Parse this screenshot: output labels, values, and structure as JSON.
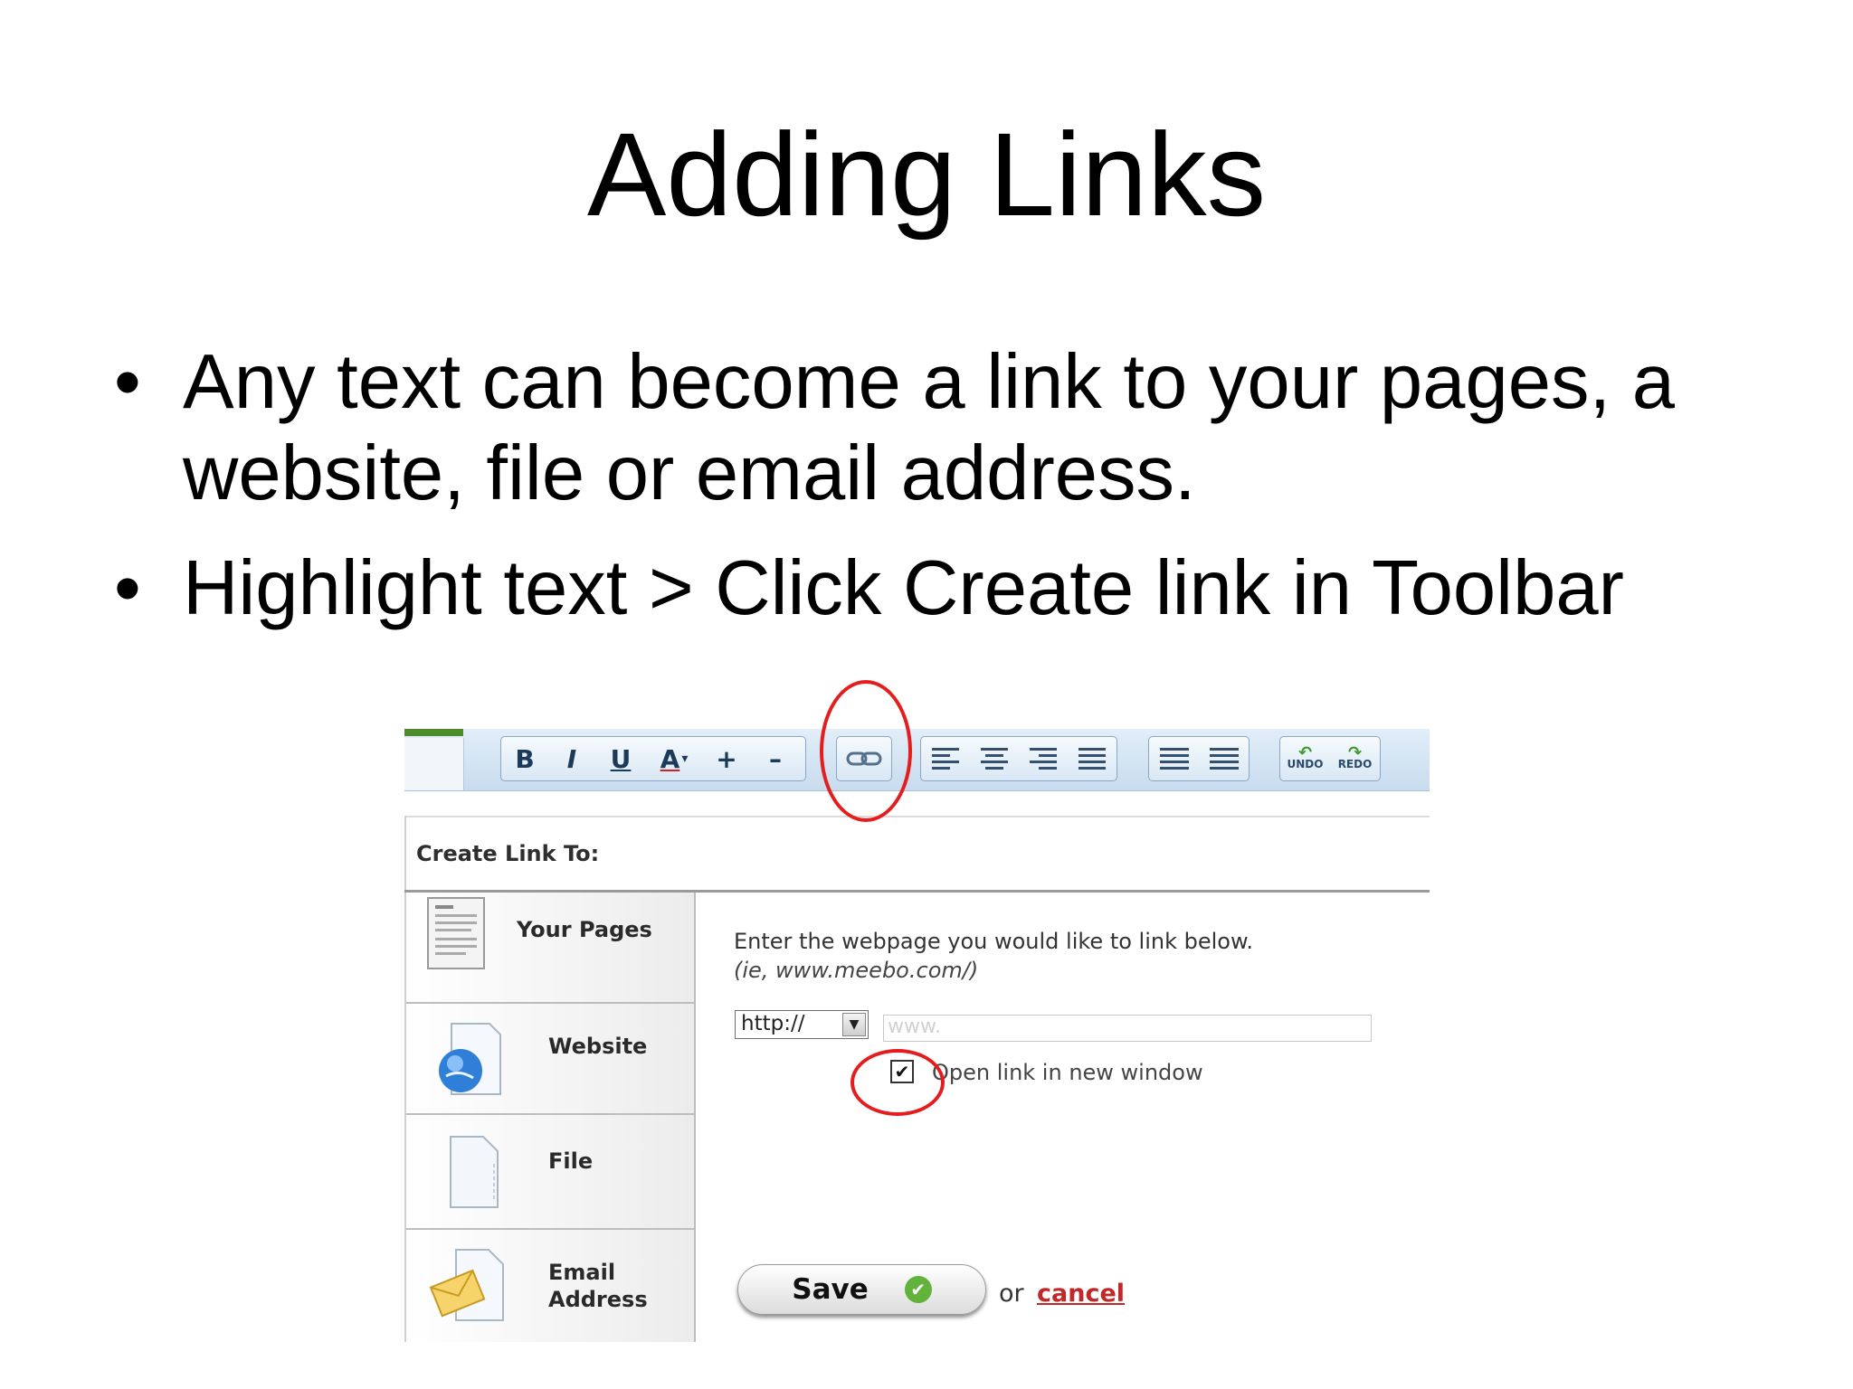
{
  "slide": {
    "title": "Adding Links",
    "bullets": [
      "Any text can become a link to your pages, a website, file or email address.",
      "Highlight text > Click Create link in Toolbar"
    ],
    "bullet_symbol": "•"
  },
  "toolbar": {
    "bold": "B",
    "italic": "I",
    "underline": "U",
    "font_color": "A",
    "font_color_arrow": "▾",
    "increase_size": "+",
    "decrease_size": "–",
    "create_link_icon": "link-icon",
    "undo_label": "UNDO",
    "redo_label": "REDO",
    "undo_glyph": "↶",
    "redo_glyph": "↷"
  },
  "dialog": {
    "heading": "Create Link To:",
    "options": [
      {
        "label": "Your Pages",
        "icon": "document-icon"
      },
      {
        "label": "Website",
        "icon": "globe-icon"
      },
      {
        "label": "File",
        "icon": "file-icon"
      },
      {
        "label": "Email Address",
        "icon": "envelope-icon"
      }
    ],
    "instruction": "Enter the webpage you would like to link below.",
    "example": "(ie, www.meebo.com/)",
    "protocol_value": "http://",
    "protocol_arrow": "▼",
    "url_placeholder": "www.",
    "checkbox_mark": "✔",
    "checkbox_label": "Open link in new window",
    "save_label": "Save",
    "save_check": "✔",
    "or_text": "or",
    "cancel_label": "cancel"
  },
  "colors": {
    "highlight_ring": "#e41e1e",
    "cancel_link": "#c0282a",
    "toolbar_bg": "#d3e4f3"
  }
}
